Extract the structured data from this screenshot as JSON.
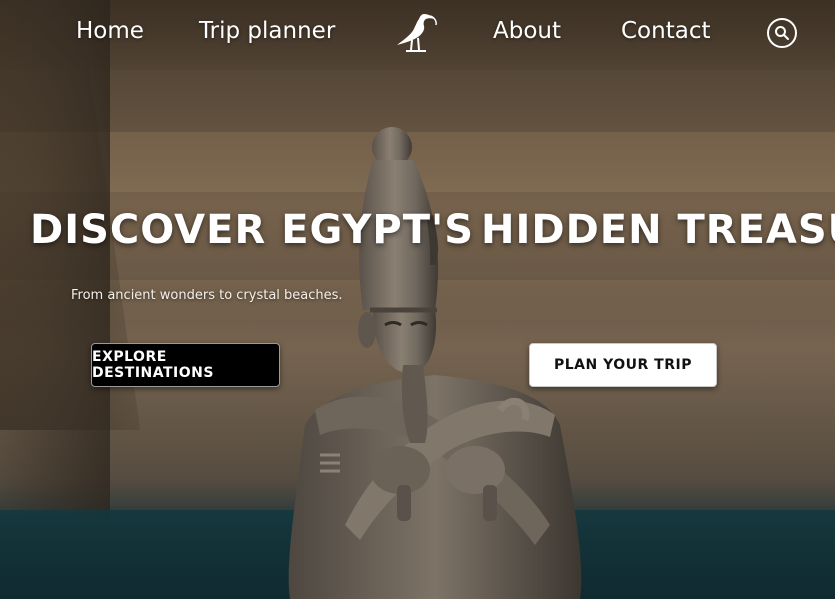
{
  "nav": {
    "home_label": "Home",
    "trip_planner_label": "Trip planner",
    "about_label": "About",
    "contact_label": "Contact",
    "logo_icon": "ibis-bird-icon",
    "search_icon": "search-icon"
  },
  "hero": {
    "title_left": "DISCOVER EGYPT'S",
    "title_right": "HIDDEN TREASURES",
    "subtitle": "From ancient wonders to crystal beaches.",
    "explore_button_label": "EXPLORE DESTINATIONS",
    "plan_button_label": "PLAN YOUR TRIP"
  },
  "colors": {
    "text": "#ffffff",
    "explore_button_bg": "#000000",
    "plan_button_bg": "#ffffff",
    "plan_button_text": "#111111"
  }
}
